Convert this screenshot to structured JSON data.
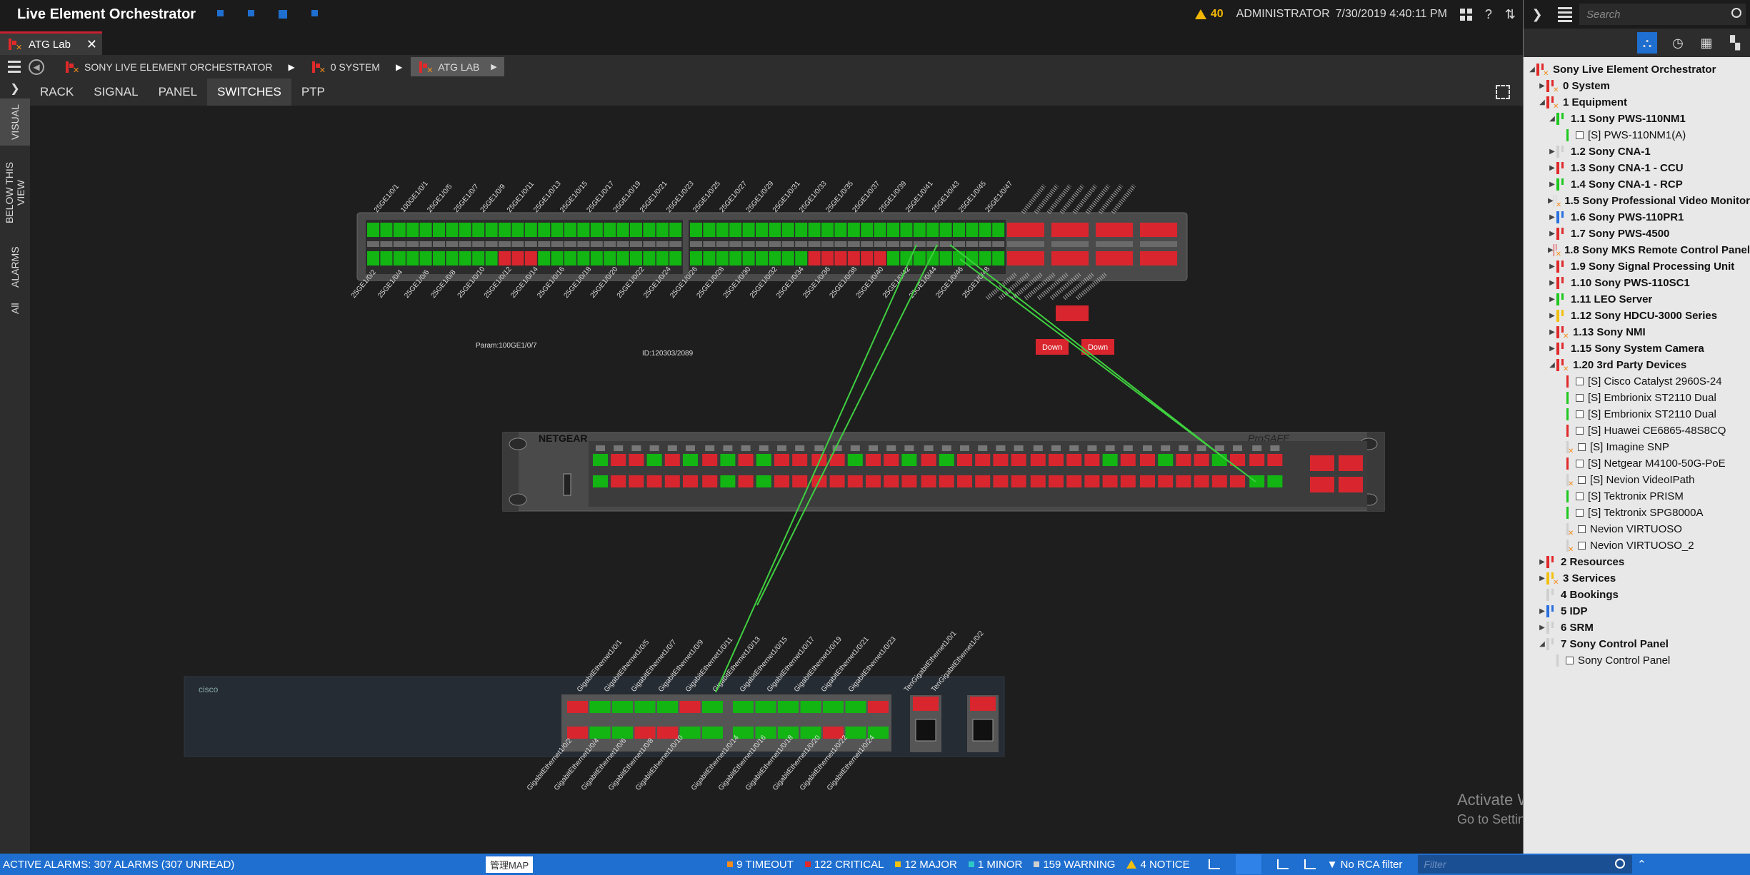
{
  "app": {
    "title": "Live Element Orchestrator",
    "alarm_count": "40",
    "user": "ADMINISTRATOR",
    "datetime": "7/30/2019 4:40:11 PM",
    "help": "?"
  },
  "tabs": [
    {
      "label": "ATG Lab"
    }
  ],
  "breadcrumb": [
    {
      "label": "SONY LIVE ELEMENT ORCHESTRATOR"
    },
    {
      "label": "0 SYSTEM"
    },
    {
      "label": "ATG LAB"
    }
  ],
  "side_tabs": [
    {
      "label": "VISUAL"
    },
    {
      "label": "BELOW THIS VIEW"
    },
    {
      "label": "ALARMS"
    },
    {
      "label": "All"
    }
  ],
  "view_tabs": [
    {
      "label": "RACK"
    },
    {
      "label": "SIGNAL"
    },
    {
      "label": "PANEL"
    },
    {
      "label": "SWITCHES"
    },
    {
      "label": "PTP"
    }
  ],
  "canvas": {
    "param_label": "Param:100GE1/0/7",
    "id_label": "ID:120303/2089",
    "down_labels": [
      "Down",
      "Down"
    ],
    "netgear_brand": "NETGEAR",
    "prosafe_brand": "ProSAFE",
    "cisco_brand": "cisco",
    "sw1_top_ports": [
      "25GE1/0/1",
      "100GE1/0/1",
      "25GE1/0/5",
      "25GE1/0/7",
      "25GE1/0/9",
      "25GE1/0/11",
      "25GE1/0/13",
      "25GE1/0/15",
      "25GE1/0/17",
      "25GE1/0/19",
      "25GE1/0/21",
      "25GE1/0/23",
      "25GE1/0/25",
      "25GE1/0/27",
      "25GE1/0/29",
      "25GE1/0/31",
      "25GE1/0/33",
      "25GE1/0/35",
      "25GE1/0/37",
      "25GE1/0/39",
      "25GE1/0/41",
      "25GE1/0/43",
      "25GE1/0/45",
      "25GE1/0/47"
    ],
    "sw1_bottom_ports": [
      "25GE1/0/2",
      "25GE1/0/4",
      "25GE1/0/6",
      "25GE1/0/8",
      "25GE1/0/10",
      "25GE1/0/12",
      "25GE1/0/14",
      "25GE1/0/16",
      "25GE1/0/18",
      "25GE1/0/20",
      "25GE1/0/22",
      "25GE1/0/24",
      "25GE1/0/26",
      "25GE1/0/28",
      "25GE1/0/30",
      "25GE1/0/32",
      "25GE1/0/34",
      "25GE1/0/36",
      "25GE1/0/38",
      "25GE1/0/40",
      "25GE1/0/42",
      "25GE1/0/44",
      "25GE1/0/46",
      "25GE1/0/48"
    ],
    "cisco_top_ports": [
      "GigabitEthernet1/0/1",
      "GigabitEthernet1/0/5",
      "GigabitEthernet1/0/7",
      "GigabitEthernet1/0/9",
      "GigabitEthernet1/0/11",
      "GigabitEthernet1/0/13",
      "GigabitEthernet1/0/15",
      "GigabitEthernet1/0/17",
      "GigabitEthernet1/0/19",
      "GigabitEthernet1/0/21",
      "GigabitEthernet1/0/23",
      "TenGigabitEthernet1/0/1",
      "TenGigabitEthernet1/0/2"
    ],
    "cisco_bottom_ports": [
      "GigabitEthernet1/0/2",
      "GigabitEthernet1/0/4",
      "GigabitEthernet1/0/6",
      "GigabitEthernet1/0/8",
      "GigabitEthernet1/0/10",
      "GigabitEthernet1/0/14",
      "GigabitEthernet1/0/16",
      "GigabitEthernet1/0/18",
      "GigabitEthernet1/0/20",
      "GigabitEthernet1/0/22",
      "GigabitEthernet1/0/24"
    ]
  },
  "switches": {
    "sw1": {
      "top": "GGGGGGGGGGGGGGGGGGGGGGGGGGGGGGGGGGGGGGGGGGGGGGGGGGGGGGGG",
      "bottom": "GGGGGGGGGGRRRGGGGGGGGGGGGGGGGGGGGRRRRRRGGGGGGGGGG",
      "sfp_top": "RRRR",
      "sfp_bottom": "RRRR"
    },
    "netgear": {
      "top": "GRRGRGRGRGRRRRGRRGRGRRRRRRRRGRRGRRGRRRG",
      "bottom": "GRRRRRRGRGRRRRRRRRRRRRRRRRRRRRRRRRRRGGR",
      "sfp": "RRRR"
    },
    "cisco": {
      "top": "RGGGGRGGGGGGGR",
      "bottom": "RGGRRGGGGGGRGG",
      "sfp": "RR"
    }
  },
  "colors": {
    "green": "#12b512",
    "red": "#d9262e",
    "link": "#3fd03f"
  },
  "search": {
    "placeholder": "Search"
  },
  "tree": [
    {
      "label": "Sony Live Element Orchestrator",
      "level": 0,
      "bold": true,
      "arrow": "down",
      "color": "#e02a2a",
      "x": true
    },
    {
      "label": "0 System",
      "level": 1,
      "bold": true,
      "arrow": "right",
      "color": "#e02a2a",
      "x": true
    },
    {
      "label": "1 Equipment",
      "level": 1,
      "bold": true,
      "arrow": "down",
      "color": "#e02a2a",
      "x": true
    },
    {
      "label": "1.1 Sony PWS-110NM1",
      "level": 2,
      "bold": true,
      "arrow": "down",
      "color": "#1ec81e",
      "x": false
    },
    {
      "label": "[S] PWS-110NM1(A)",
      "level": 3,
      "bold": false,
      "arrow": "",
      "color": "#1ec81e",
      "x": false,
      "chk": true
    },
    {
      "label": "1.2 Sony CNA-1",
      "level": 2,
      "bold": true,
      "arrow": "right",
      "color": "#cfcfcf",
      "x": false
    },
    {
      "label": "1.3 Sony CNA-1 - CCU",
      "level": 2,
      "bold": true,
      "arrow": "right",
      "color": "#e02a2a",
      "x": false
    },
    {
      "label": "1.4 Sony CNA-1 - RCP",
      "level": 2,
      "bold": true,
      "arrow": "right",
      "color": "#1ec81e",
      "x": false
    },
    {
      "label": "1.5 Sony Professional Video Monitor",
      "level": 2,
      "bold": true,
      "arrow": "right",
      "color": "#cfcfcf",
      "x": true
    },
    {
      "label": "1.6 Sony PWS-110PR1",
      "level": 2,
      "bold": true,
      "arrow": "right",
      "color": "#2a6fe0",
      "x": false
    },
    {
      "label": "1.7 Sony PWS-4500",
      "level": 2,
      "bold": true,
      "arrow": "right",
      "color": "#e02a2a",
      "x": false
    },
    {
      "label": "1.8 Sony MKS Remote Control Panel",
      "level": 2,
      "bold": true,
      "arrow": "right",
      "color": "#e02a2a",
      "x": true
    },
    {
      "label": "1.9 Sony Signal Processing Unit",
      "level": 2,
      "bold": true,
      "arrow": "right",
      "color": "#e02a2a",
      "x": false
    },
    {
      "label": "1.10 Sony PWS-110SC1",
      "level": 2,
      "bold": true,
      "arrow": "right",
      "color": "#e02a2a",
      "x": false
    },
    {
      "label": "1.11 LEO Server",
      "level": 2,
      "bold": true,
      "arrow": "right",
      "color": "#1ec81e",
      "x": false
    },
    {
      "label": "1.12 Sony HDCU-3000 Series",
      "level": 2,
      "bold": true,
      "arrow": "right",
      "color": "#f2c00f",
      "x": false
    },
    {
      "label": "1.13 Sony NMI",
      "level": 2,
      "bold": true,
      "arrow": "right",
      "color": "#e02a2a",
      "x": true
    },
    {
      "label": "1.15 Sony System Camera",
      "level": 2,
      "bold": true,
      "arrow": "right",
      "color": "#e02a2a",
      "x": false
    },
    {
      "label": "1.20 3rd Party Devices",
      "level": 2,
      "bold": true,
      "arrow": "down",
      "color": "#e02a2a",
      "x": true
    },
    {
      "label": "[S] Cisco Catalyst 2960S-24",
      "level": 3,
      "bold": false,
      "arrow": "",
      "color": "#e02a2a",
      "x": false,
      "chk": true
    },
    {
      "label": "[S] Embrionix  ST2110 Dual",
      "level": 3,
      "bold": false,
      "arrow": "",
      "color": "#1ec81e",
      "x": false,
      "chk": true
    },
    {
      "label": "[S] Embrionix  ST2110 Dual",
      "level": 3,
      "bold": false,
      "arrow": "",
      "color": "#1ec81e",
      "x": false,
      "chk": true
    },
    {
      "label": "[S] Huawei CE6865-48S8CQ",
      "level": 3,
      "bold": false,
      "arrow": "",
      "color": "#e02a2a",
      "x": false,
      "chk": true
    },
    {
      "label": "[S] Imagine SNP",
      "level": 3,
      "bold": false,
      "arrow": "",
      "color": "#cfcfcf",
      "x": true,
      "chk": true
    },
    {
      "label": "[S] Netgear M4100-50G-PoE",
      "level": 3,
      "bold": false,
      "arrow": "",
      "color": "#e02a2a",
      "x": false,
      "chk": true
    },
    {
      "label": "[S] Nevion VideoIPath",
      "level": 3,
      "bold": false,
      "arrow": "",
      "color": "#cfcfcf",
      "x": true,
      "chk": true
    },
    {
      "label": "[S] Tektronix PRISM",
      "level": 3,
      "bold": false,
      "arrow": "",
      "color": "#1ec81e",
      "x": false,
      "chk": true
    },
    {
      "label": "[S] Tektronix SPG8000A",
      "level": 3,
      "bold": false,
      "arrow": "",
      "color": "#1ec81e",
      "x": false,
      "chk": true
    },
    {
      "label": "Nevion VIRTUOSO",
      "level": 3,
      "bold": false,
      "arrow": "",
      "color": "#cfcfcf",
      "x": true,
      "chk": true
    },
    {
      "label": "Nevion VIRTUOSO_2",
      "level": 3,
      "bold": false,
      "arrow": "",
      "color": "#cfcfcf",
      "x": true,
      "chk": true
    },
    {
      "label": "2 Resources",
      "level": 1,
      "bold": true,
      "arrow": "right",
      "color": "#e02a2a",
      "x": false
    },
    {
      "label": "3 Services",
      "level": 1,
      "bold": true,
      "arrow": "right",
      "color": "#f2c00f",
      "x": true
    },
    {
      "label": "4 Bookings",
      "level": 1,
      "bold": true,
      "arrow": "",
      "color": "#cfcfcf",
      "x": false
    },
    {
      "label": "5 IDP",
      "level": 1,
      "bold": true,
      "arrow": "right",
      "color": "#2a6fe0",
      "x": false
    },
    {
      "label": "6 SRM",
      "level": 1,
      "bold": true,
      "arrow": "right",
      "color": "#cfcfcf",
      "x": false
    },
    {
      "label": "7 Sony Control Panel",
      "level": 1,
      "bold": true,
      "arrow": "down",
      "color": "#cfcfcf",
      "x": false
    },
    {
      "label": "Sony Control Panel",
      "level": 2,
      "bold": false,
      "arrow": "",
      "color": "#cfcfcf",
      "x": false,
      "chk": true
    }
  ],
  "status": {
    "alarms_text": "ACTIVE ALARMS: 307 ALARMS (307 UNREAD)",
    "map_button": "管理MAP",
    "counts": [
      {
        "label": "9 TIMEOUT",
        "color": "#f28c1c"
      },
      {
        "label": "122 CRITICAL",
        "color": "#e02a2a"
      },
      {
        "label": "12 MAJOR",
        "color": "#f2c00f"
      },
      {
        "label": "1 MINOR",
        "color": "#2ec8c8"
      },
      {
        "label": "159 WARNING",
        "color": "#cfcfcf"
      },
      {
        "label": "4 NOTICE",
        "color": "#f2c00f"
      }
    ],
    "rca_filter": "No RCA filter",
    "filter_placeholder": "Filter"
  },
  "watermark": {
    "title": "Activate Windows",
    "subtitle": "Go to Settings to activate Windows."
  }
}
